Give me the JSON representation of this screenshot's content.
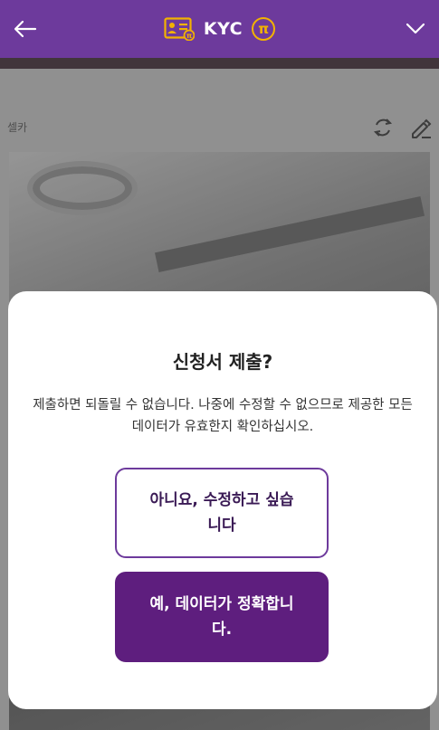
{
  "header": {
    "title": "KYC",
    "back_icon": "arrow-left-icon",
    "id_card_icon": "id-card-icon",
    "pi_logo": "π",
    "chevron_icon": "chevron-down-icon",
    "background_color": "#6d3a9c",
    "accent_gold": "#f2b200"
  },
  "page": {
    "selfie_label": "셀카",
    "rotate_icon": "rotate-icon",
    "edit_icon": "edit-pencil-icon"
  },
  "dialog": {
    "title": "신청서 제출?",
    "message": "제출하면 되돌릴 수 없습니다. 나중에 수정할 수 없으므로 제공한 모든 데이터가 유효한지 확인하십시오.",
    "no_button": "아니요, 수정하고 싶습니다",
    "yes_button": "예, 데이터가 정확합니다.",
    "primary_color": "#5e1e7e"
  }
}
